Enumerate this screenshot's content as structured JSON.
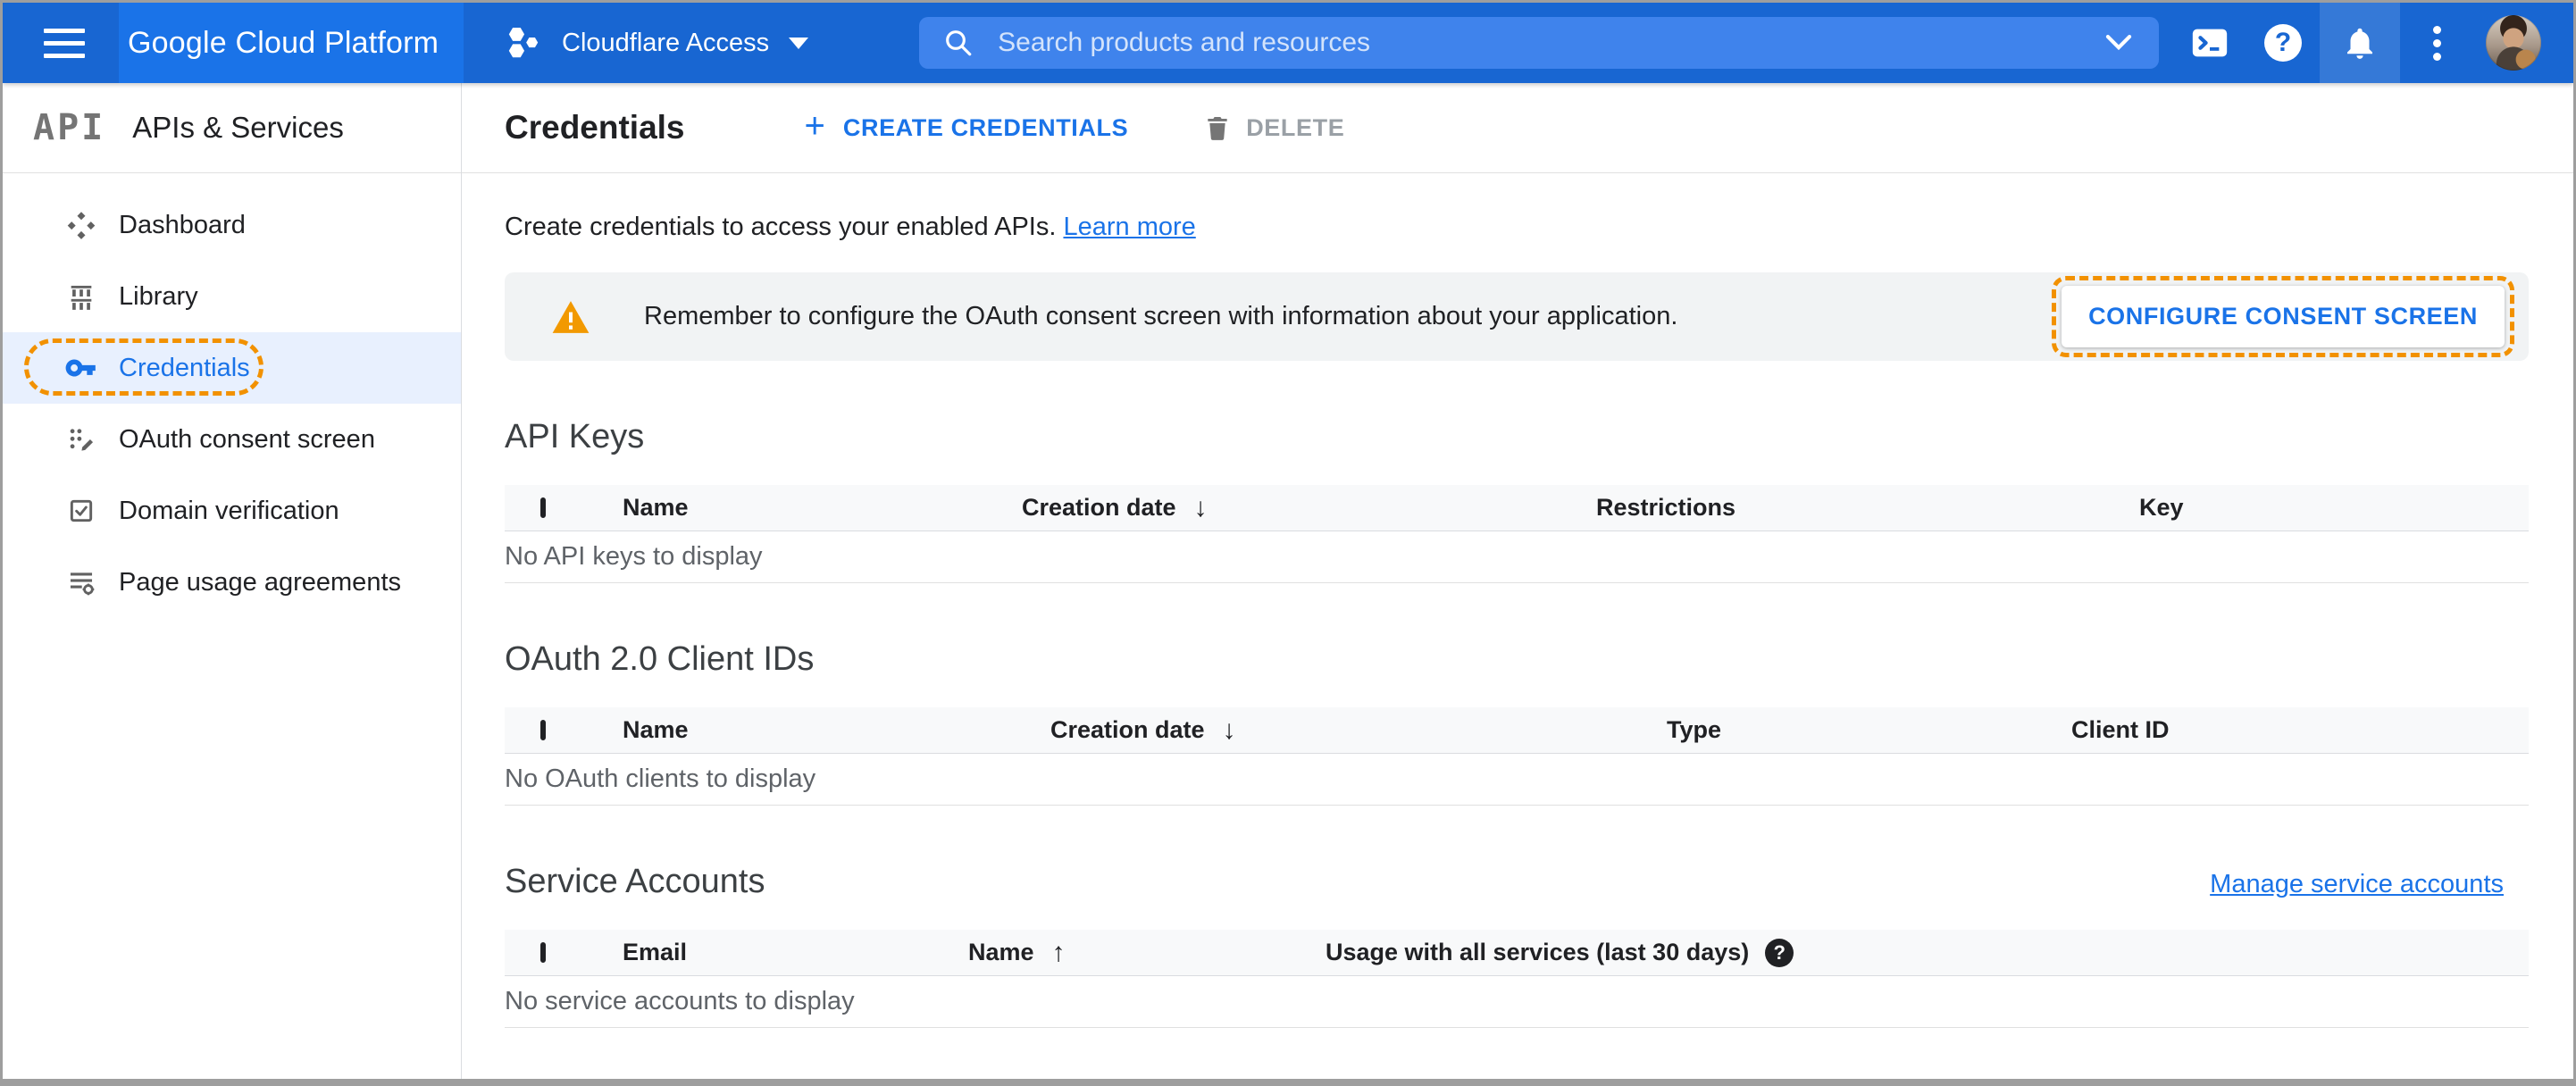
{
  "header": {
    "product": "Google Cloud Platform",
    "project": "Cloudflare Access",
    "search_placeholder": "Search products and resources"
  },
  "sidebar": {
    "logo": "API",
    "title": "APIs & Services",
    "items": [
      {
        "label": "Dashboard"
      },
      {
        "label": "Library"
      },
      {
        "label": "Credentials",
        "active": true
      },
      {
        "label": "OAuth consent screen"
      },
      {
        "label": "Domain verification"
      },
      {
        "label": "Page usage agreements"
      }
    ]
  },
  "toolbar": {
    "title": "Credentials",
    "create_plus": "+",
    "create_label": "CREATE CREDENTIALS",
    "delete_label": "DELETE"
  },
  "intro": {
    "text": "Create credentials to access your enabled APIs.",
    "link": "Learn more"
  },
  "banner": {
    "text": "Remember to configure the OAuth consent screen with information about your application.",
    "button": "CONFIGURE CONSENT SCREEN"
  },
  "sections": [
    {
      "title": "API Keys",
      "columns": [
        "Name",
        "Creation date",
        "Restrictions",
        "Key"
      ],
      "sort": "descending on Creation date",
      "empty": "No API keys to display"
    },
    {
      "title": "OAuth 2.0 Client IDs",
      "columns": [
        "Name",
        "Creation date",
        "Type",
        "Client ID"
      ],
      "sort": "descending on Creation date",
      "empty": "No OAuth clients to display"
    },
    {
      "title": "Service Accounts",
      "link": "Manage service accounts",
      "columns": [
        "Email",
        "Name",
        "Usage with all services (last 30 days)"
      ],
      "sort": "ascending on Name",
      "empty": "No service accounts to display"
    }
  ],
  "icons": {
    "sort_desc": "↓",
    "sort_asc": "↑",
    "help": "?"
  },
  "colors": {
    "accent_blue": "#1a73e8",
    "topbar_blue": "#1866d2",
    "active_row_bg": "#e8f0fe",
    "annotation_orange": "#f29100",
    "warning_orange": "#f29900",
    "banner_bg": "#f1f3f4",
    "table_header_bg": "#f8f9fa"
  }
}
